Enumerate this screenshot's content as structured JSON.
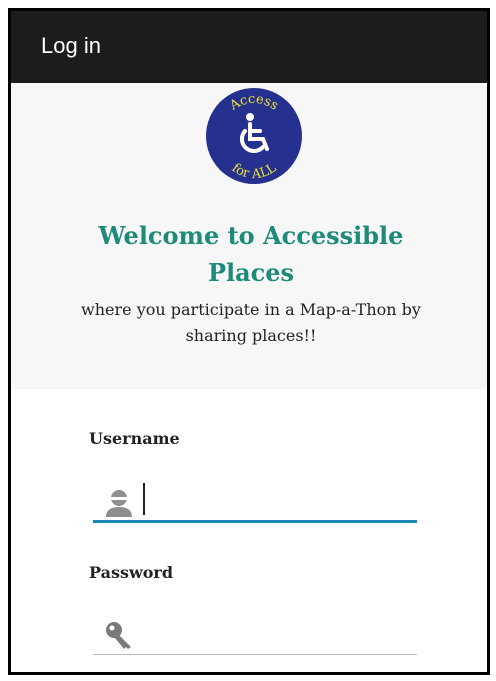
{
  "app_bar": {
    "title": "Log in"
  },
  "logo": {
    "text_top": "Access",
    "text_bottom": "for ALL",
    "icon": "wheelchair-icon",
    "background_color": "#26308f",
    "text_color": "#e8e23a"
  },
  "welcome": {
    "title_line1": "Welcome to Accessible",
    "title_line2": "Places",
    "subtitle_line1": "where you participate in a Map-a-Thon by",
    "subtitle_line2": "sharing places!!"
  },
  "form": {
    "username": {
      "label": "Username",
      "value": "",
      "icon": "user-icon"
    },
    "password": {
      "label": "Password",
      "value": "",
      "icon": "key-icon"
    }
  },
  "colors": {
    "app_bar": "#1c1c1c",
    "title": "#1e8a7a",
    "focus": "#1a87b5"
  }
}
